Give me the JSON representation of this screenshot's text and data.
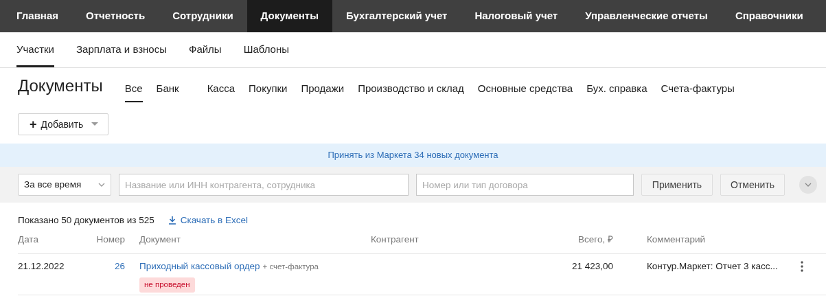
{
  "top_nav": [
    {
      "label": "Главная",
      "selected": false
    },
    {
      "label": "Отчетность",
      "selected": false
    },
    {
      "label": "Сотрудники",
      "selected": false
    },
    {
      "label": "Документы",
      "selected": true
    },
    {
      "label": "Бухгалтерский учет",
      "selected": false
    },
    {
      "label": "Налоговый учет",
      "selected": false
    },
    {
      "label": "Управленческие отчеты",
      "selected": false
    },
    {
      "label": "Справочники",
      "selected": false
    }
  ],
  "sub_nav": [
    {
      "label": "Участки",
      "selected": true
    },
    {
      "label": "Зарплата и взносы",
      "selected": false
    },
    {
      "label": "Файлы",
      "selected": false
    },
    {
      "label": "Шаблоны",
      "selected": false
    }
  ],
  "page_title": "Документы",
  "doc_tabs": [
    {
      "label": "Все",
      "selected": true
    },
    {
      "label": "Банк",
      "selected": false
    },
    {
      "label": "Касса",
      "selected": false
    },
    {
      "label": "Покупки",
      "selected": false
    },
    {
      "label": "Продажи",
      "selected": false
    },
    {
      "label": "Производство и склад",
      "selected": false
    },
    {
      "label": "Основные средства",
      "selected": false
    },
    {
      "label": "Бух. справка",
      "selected": false
    },
    {
      "label": "Счета-фактуры",
      "selected": false
    }
  ],
  "add_button": {
    "icon": "+",
    "label": "Добавить"
  },
  "banner": "Принять из Маркета 34 новых документа",
  "filters": {
    "period": "За все время",
    "counterparty": {
      "placeholder": "Название или ИНН контрагента, сотрудника"
    },
    "contract": {
      "placeholder": "Номер или тип договора"
    },
    "apply": "Применить",
    "cancel": "Отменить"
  },
  "summary": "Показано 50 документов из 525",
  "download": "Скачать в Excel",
  "table": {
    "columns": [
      "Дата",
      "Номер",
      "Документ",
      "Контрагент",
      "Всего, ₽",
      "Комментарий"
    ],
    "rows": [
      {
        "date": "21.12.2022",
        "number": "26",
        "document": "Приходный кассовый ордер",
        "addon": "+ счет-фактура",
        "status": "не проведен",
        "total": "21 423,00",
        "comment": "Контур.Маркет: Отчет 3 касс..."
      }
    ]
  }
}
